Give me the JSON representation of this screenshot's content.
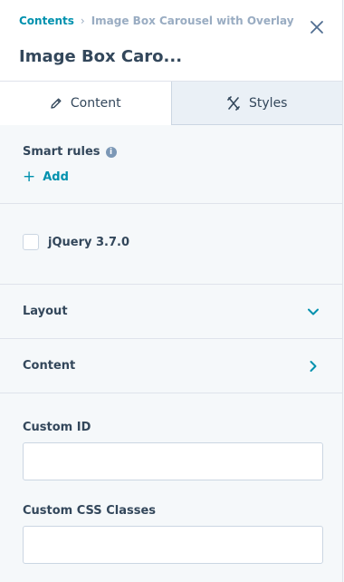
{
  "breadcrumb": {
    "root": "Contents",
    "separator": "›",
    "current": "Image Box Carousel with Overlay"
  },
  "header": {
    "title": "Image Box Caro..."
  },
  "tabs": [
    {
      "label": "Content",
      "icon": "pencil-icon"
    },
    {
      "label": "Styles",
      "icon": "styles-tools-icon"
    }
  ],
  "smart_rules": {
    "label": "Smart rules",
    "info_icon": "i",
    "add_label": "Add",
    "add_icon": "+"
  },
  "jquery": {
    "label": "jQuery 3.7.0",
    "checked": false
  },
  "sections": {
    "layout": "Layout",
    "content": "Content"
  },
  "fields": {
    "custom_id": {
      "label": "Custom ID",
      "value": "",
      "placeholder": ""
    },
    "custom_css": {
      "label": "Custom CSS Classes",
      "value": "",
      "placeholder": ""
    }
  },
  "colors": {
    "accent": "#0091ae",
    "text": "#33475b",
    "muted": "#99acc2",
    "bg": "#f5f8fa"
  }
}
